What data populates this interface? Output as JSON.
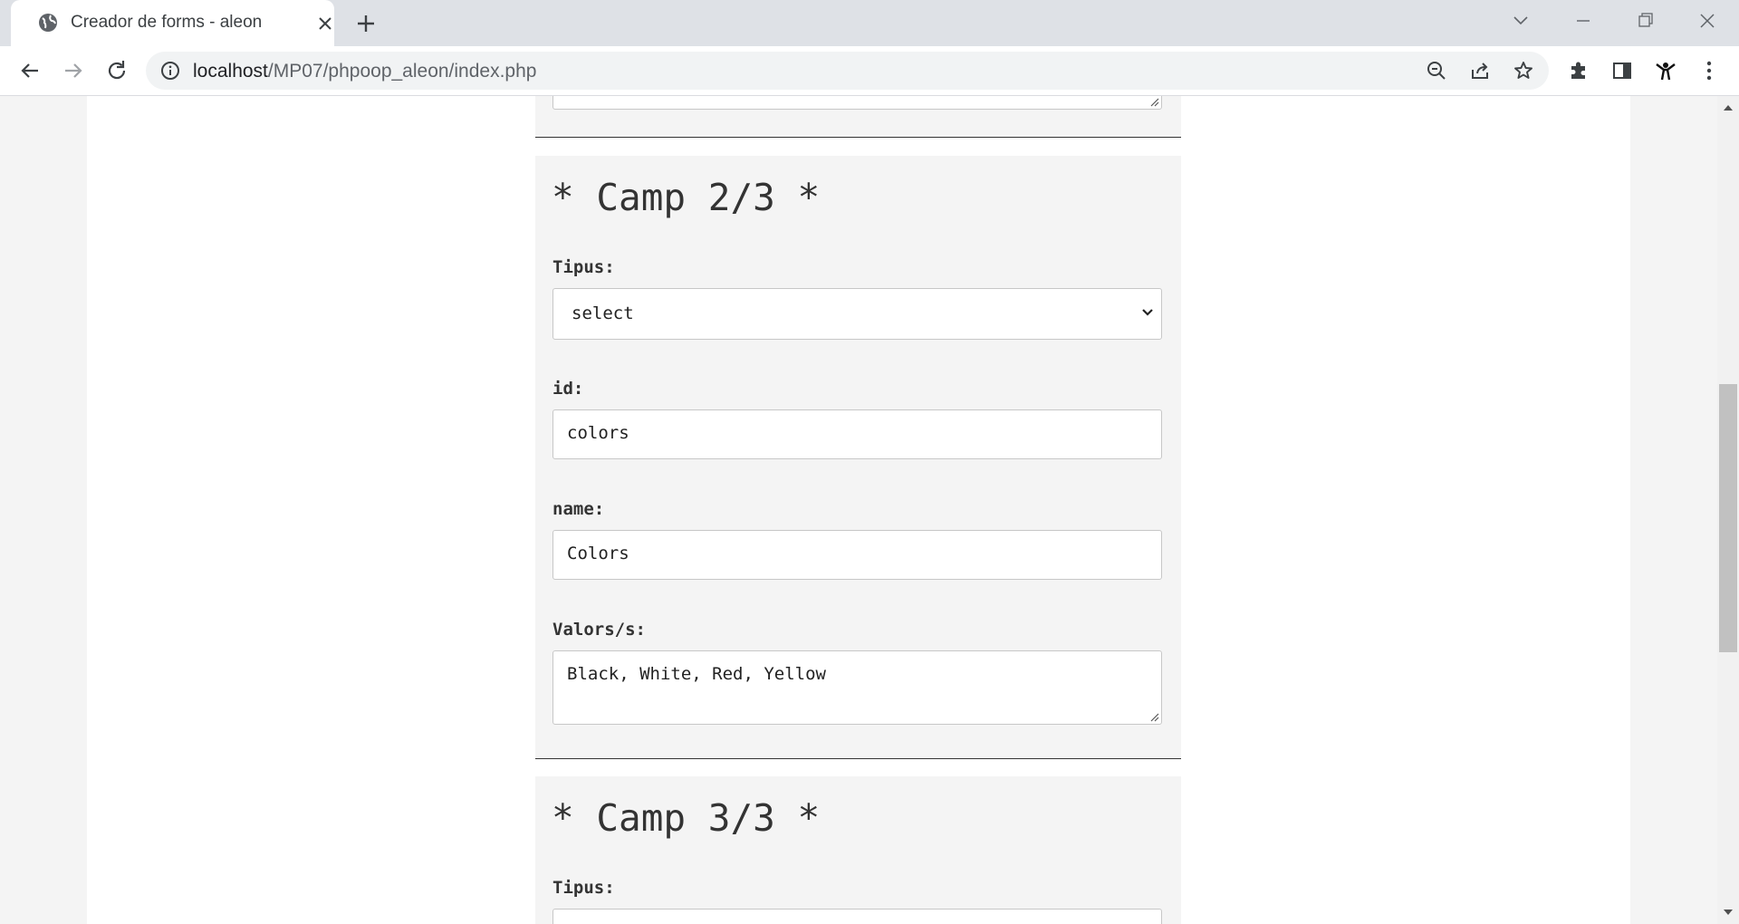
{
  "browser": {
    "tab_title": "Creador de forms - aleon",
    "url_host": "localhost",
    "url_path": "/MP07/phpoop_aleon/index.php"
  },
  "fields": [
    {
      "heading": "* Camp 2/3 *",
      "tipus_label": "Tipus:",
      "tipus_value": "select",
      "id_label": "id:",
      "id_value": "colors",
      "name_label": "name:",
      "name_value": "Colors",
      "valors_label": "Valors/s:",
      "valors_value": "Black, White, Red, Yellow"
    },
    {
      "heading": "* Camp 3/3 *",
      "tipus_label": "Tipus:"
    }
  ],
  "icons": {
    "tab_favicon": "globe-icon",
    "tab_close": "close-icon",
    "new_tab": "plus-icon",
    "back": "arrow-left-icon",
    "forward": "arrow-right-icon",
    "reload": "reload-icon",
    "site_info": "info-icon",
    "zoom": "zoom-out-icon",
    "share": "share-icon",
    "bookmark": "star-icon",
    "extensions": "puzzle-icon",
    "side_panel": "side-panel-icon",
    "profile": "profile-icon",
    "menu": "kebab-menu-icon"
  },
  "colors": {
    "tabbar": "#dee1e6",
    "page_background": "#f4f4f4",
    "panel_background": "#f4f4f4",
    "text": "#333333"
  }
}
